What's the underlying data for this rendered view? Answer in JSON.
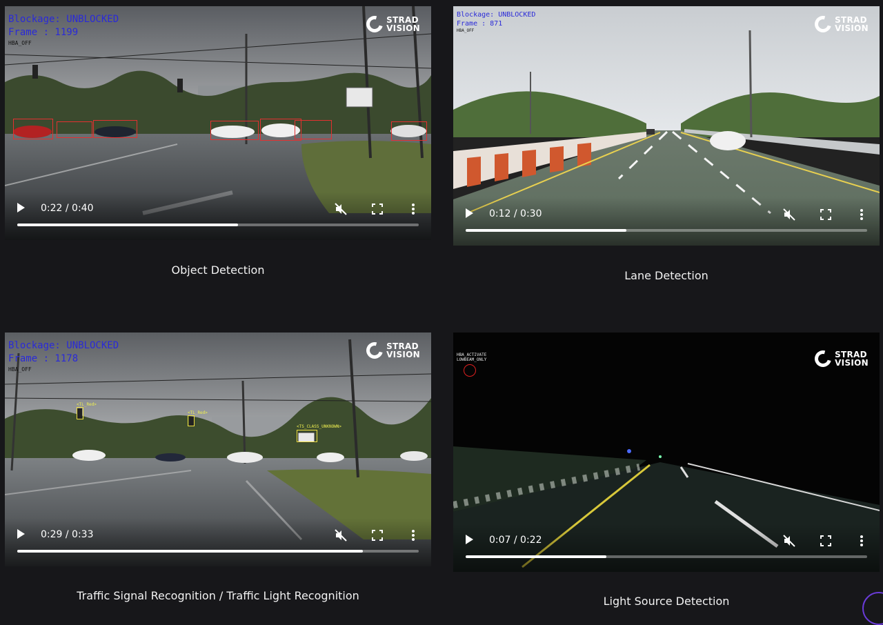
{
  "brand": {
    "logo_line1": "STRAD",
    "logo_line2": "VISION"
  },
  "videos": [
    {
      "id": "object-detection",
      "caption": "Object Detection",
      "overlay": {
        "line1": "Blockage: UNBLOCKED",
        "line2": "Frame : 1199",
        "line3": "HBA_OFF"
      },
      "time": "0:22 / 0:40",
      "progress": 0.55
    },
    {
      "id": "lane-detection",
      "caption": "Lane Detection",
      "overlay": {
        "line1": "Blockage: UNBLOCKED",
        "line2": "Frame : 871",
        "line3": "HBA_OFF"
      },
      "time": "0:12 / 0:30",
      "progress": 0.4
    },
    {
      "id": "traffic-signal",
      "caption": "Traffic Signal Recognition / Traffic Light Recognition",
      "overlay": {
        "line1": "Blockage: UNBLOCKED",
        "line2": "Frame : 1178",
        "line3": "HBA_OFF"
      },
      "time": "0:29 / 0:33",
      "progress": 0.86,
      "labels": {
        "tl_red_1": "<TL_Red>",
        "tl_red_2": "<TL_Red>",
        "ts_class": "<TS_CLASS_UNKNOWN>"
      }
    },
    {
      "id": "light-source",
      "caption": "Light Source Detection",
      "overlay": {
        "line1": "HBA_ACTIVATE",
        "line2": "LOWBEAM_ONLY"
      },
      "time": "0:07 / 0:22",
      "progress": 0.35
    }
  ],
  "colors": {
    "overlay_text": "#2a2ad8",
    "detection_box": "#e53030",
    "traffic_light_box": "#f0e040",
    "accent_arc": "#6a3bd8"
  }
}
